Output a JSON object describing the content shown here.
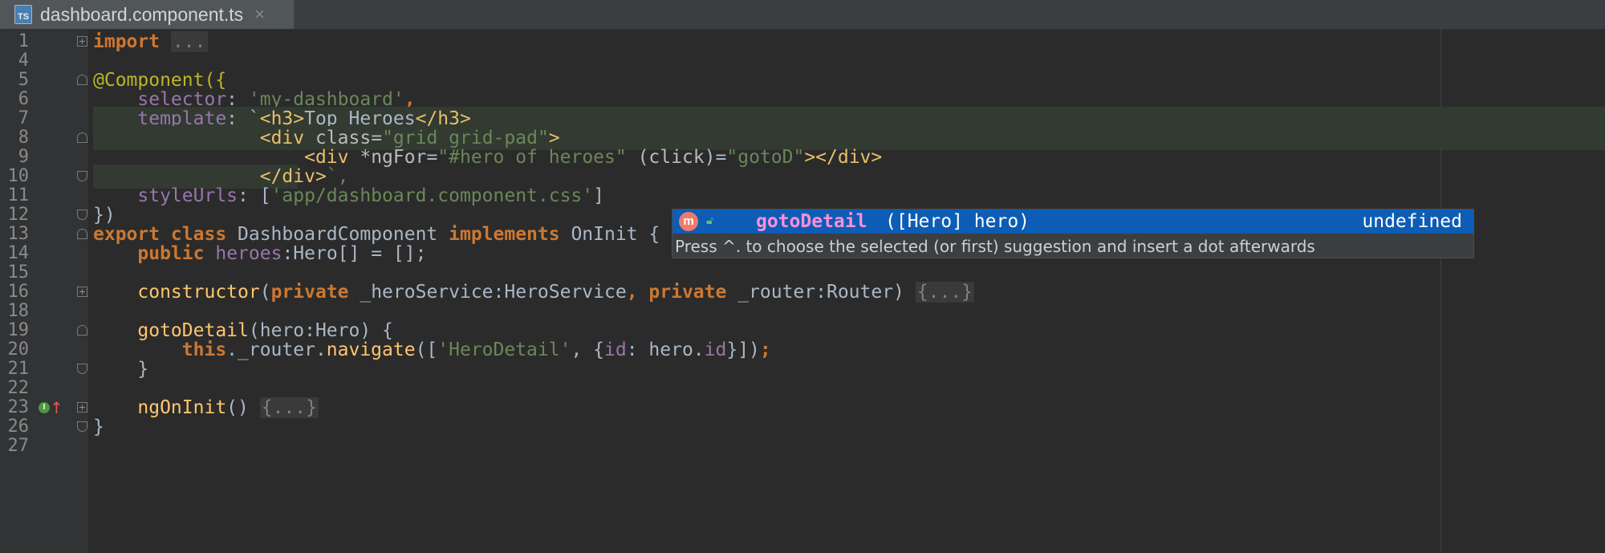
{
  "tab": {
    "icon": "typescript-file-icon",
    "icon_label": "TS",
    "title": "dashboard.component.ts",
    "close": "×"
  },
  "lines": [
    {
      "num": "1"
    },
    {
      "num": "4"
    },
    {
      "num": "5"
    },
    {
      "num": "6"
    },
    {
      "num": "7"
    },
    {
      "num": "8"
    },
    {
      "num": "9"
    },
    {
      "num": "10"
    },
    {
      "num": "11"
    },
    {
      "num": "12"
    },
    {
      "num": "13"
    },
    {
      "num": "14"
    },
    {
      "num": "15"
    },
    {
      "num": "16"
    },
    {
      "num": "18"
    },
    {
      "num": "19"
    },
    {
      "num": "20"
    },
    {
      "num": "21"
    },
    {
      "num": "22"
    },
    {
      "num": "23"
    },
    {
      "num": "26"
    },
    {
      "num": "27"
    }
  ],
  "code": {
    "l1_kw": "import",
    "l1_fold": "...",
    "l5": "@Component({",
    "l6_prop": "selector",
    "l6_sep": ": ",
    "l6_str": "'my-dashboard'",
    "l6_end": ",",
    "l7_prop": "template",
    "l7_sep": ": `",
    "l7_tag1": "<h3>",
    "l7_text": "Top Heroes",
    "l7_tag2": "</h3>",
    "l8_tag": "<div ",
    "l8_attr": "class",
    "l8_eq": "=",
    "l8_str": "\"grid grid-pad\"",
    "l8_close": ">",
    "l9_tag": "<div ",
    "l9_attr": "*ngFor",
    "l9_eq": "=",
    "l9_str": "\"#hero of heroes\"",
    "l9_sp": " ",
    "l9_attr2": "(click)",
    "l9_eq2": "=",
    "l9_str2": "\"gotoD\"",
    "l9_close": "></div>",
    "l10_tag": "</div>",
    "l10_end": "`,",
    "l11_prop": "styleUrls",
    "l11_sep": ": [",
    "l11_str": "'app/dashboard.component.css'",
    "l11_end": "]",
    "l12": "})",
    "l13_kw1": "export class",
    "l13_name": " DashboardComponent ",
    "l13_kw2": "implements",
    "l13_rest": " OnInit {",
    "l14_kw": "public",
    "l14_sp": " ",
    "l14_prop": "heroes",
    "l14_rest": ":Hero[] = [];",
    "l16_fn": "constructor",
    "l16_p1": "(",
    "l16_kw1": "private",
    "l16_p2": " _heroService:HeroService",
    "l16_comma": ", ",
    "l16_kw2": "private",
    "l16_p3": " _router:Router) ",
    "l16_fold": "{...}",
    "l19_fn": "gotoDetail",
    "l19_rest": "(hero:Hero) {",
    "l20_kw": "this",
    "l20_p1": "._router.",
    "l20_fn": "navigate",
    "l20_p2": "([",
    "l20_str": "'HeroDetail'",
    "l20_p3": ", {",
    "l20_prop": "id",
    "l20_p4": ": hero.",
    "l20_prop2": "id",
    "l20_p5": "}])",
    "l20_semi": ";",
    "l21": "}",
    "l23_fn": "ngOnInit",
    "l23_rest": "() ",
    "l23_fold": "{...}",
    "l26": "}"
  },
  "gutter_icons": {
    "implementing_icon": "I",
    "arrow": "↑"
  },
  "completion": {
    "kind_icon": "m",
    "name": "gotoDetail",
    "params": "([Hero] hero)",
    "type": "undefined",
    "hint": "Press ^. to choose the selected (or first) suggestion and insert a dot afterwards"
  },
  "colors": {
    "background": "#2b2b2b",
    "keyword": "#cc7832",
    "string": "#6a8759",
    "property": "#9876aa",
    "function": "#ffc66d",
    "selection": "#0d5cb5"
  }
}
